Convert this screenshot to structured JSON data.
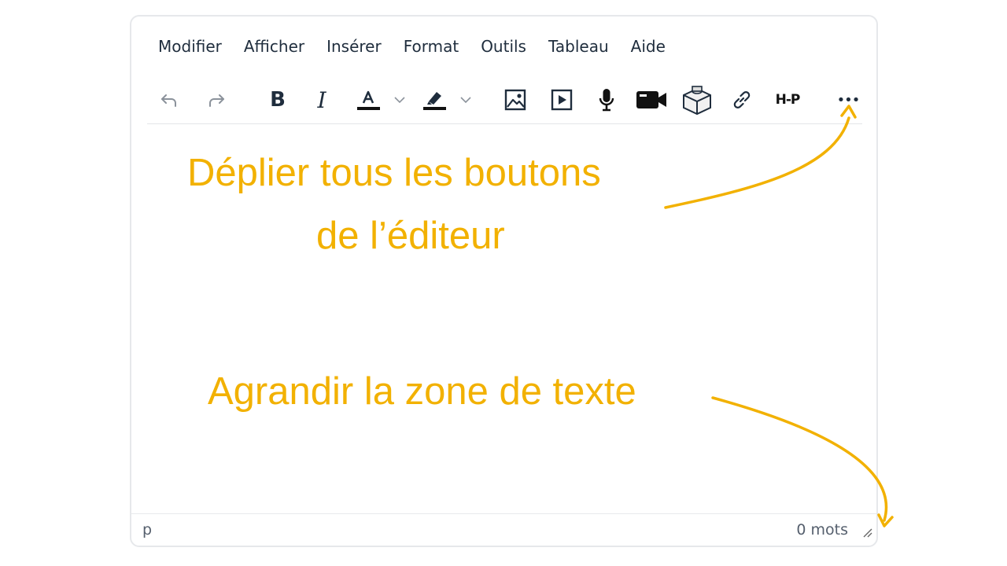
{
  "menu": [
    "Modifier",
    "Afficher",
    "Insérer",
    "Format",
    "Outils",
    "Tableau",
    "Aide"
  ],
  "toolbar": {
    "bold_label": "B",
    "italic_label": "I",
    "h5p_label": "H-P",
    "more_label": "•••"
  },
  "status": {
    "path": "p",
    "word_count": "0 mots"
  },
  "annotations": {
    "expand_buttons_line1": "Déplier tous les boutons",
    "expand_buttons_line2": "de l’éditeur",
    "resize_area": "Agrandir la zone de texte"
  },
  "colors": {
    "annotation": "#f2b100",
    "text": "#1f2d3d",
    "border": "#e6e8eb"
  }
}
